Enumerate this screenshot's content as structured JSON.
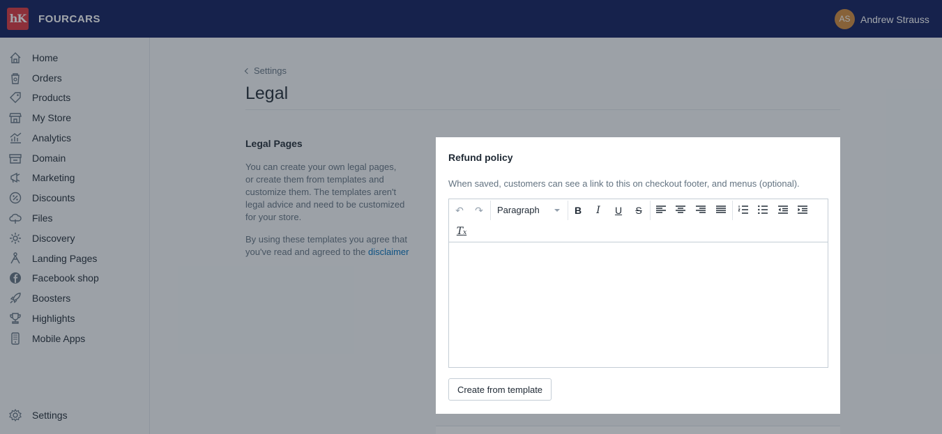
{
  "header": {
    "logo_text": "hK",
    "store_name": "FOURCARS",
    "user_initials": "AS",
    "user_name": "Andrew Strauss"
  },
  "sidebar": {
    "items": [
      {
        "label": "Home",
        "icon": "home-icon"
      },
      {
        "label": "Orders",
        "icon": "orders-icon"
      },
      {
        "label": "Products",
        "icon": "tag-icon"
      },
      {
        "label": "My Store",
        "icon": "store-icon"
      },
      {
        "label": "Analytics",
        "icon": "analytics-icon"
      },
      {
        "label": "Domain",
        "icon": "domain-icon"
      },
      {
        "label": "Marketing",
        "icon": "marketing-icon"
      },
      {
        "label": "Discounts",
        "icon": "discount-icon"
      },
      {
        "label": "Files",
        "icon": "cloud-icon"
      },
      {
        "label": "Discovery",
        "icon": "discovery-icon"
      },
      {
        "label": "Landing Pages",
        "icon": "landing-pages-icon"
      },
      {
        "label": "Facebook shop",
        "icon": "facebook-icon"
      },
      {
        "label": "Boosters",
        "icon": "rocket-icon"
      },
      {
        "label": "Highlights",
        "icon": "trophy-icon"
      },
      {
        "label": "Mobile Apps",
        "icon": "mobile-icon"
      }
    ],
    "settings_label": "Settings"
  },
  "main": {
    "breadcrumb": "Settings",
    "title": "Legal",
    "section_title": "Legal Pages",
    "section_desc": "You can create your own legal pages, or create them from templates and customize them. The templates aren't legal advice and need to be customized for your store.",
    "section_note": "By using these templates you agree that you've read and agreed to the",
    "disclaimer_link": "disclaimer"
  },
  "card": {
    "title": "Refund policy",
    "subtitle": "When saved, customers can see a link to this on checkout footer, and menus (optional).",
    "format_select": "Paragraph",
    "template_button": "Create from template"
  },
  "colors": {
    "topbar": "#0f1d5c",
    "logo": "#d9343d",
    "avatar": "#d08a3c",
    "link": "#006fbb"
  }
}
